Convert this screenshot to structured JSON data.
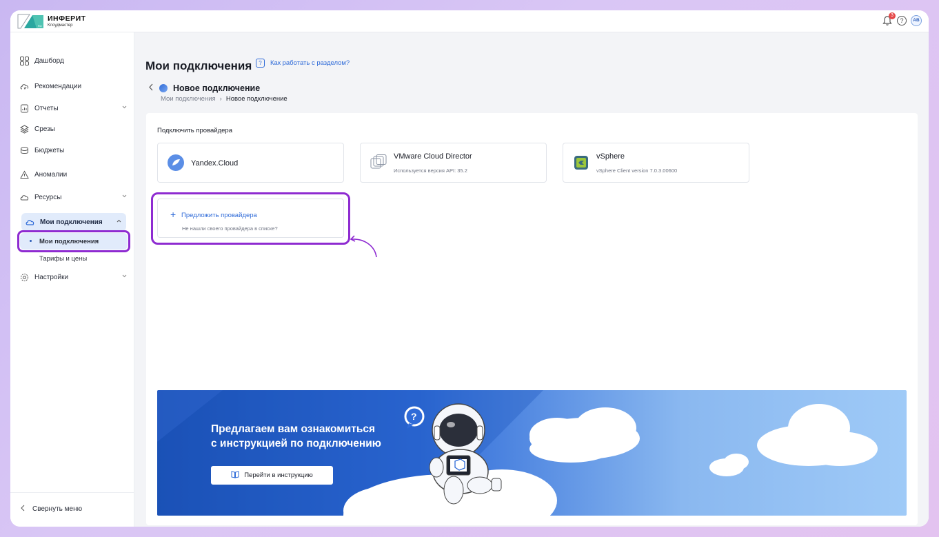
{
  "app": {
    "logo_title": "ИНФЕРИТ",
    "logo_subtitle": "Клоудмастер",
    "notifications_count": "3",
    "user_initials": "AB"
  },
  "sidebar": {
    "items": [
      {
        "label": "Дашборд",
        "icon": "dashboard-icon"
      },
      {
        "label": "Рекомендации",
        "icon": "recommendations-icon"
      },
      {
        "label": "Отчеты",
        "icon": "reports-icon"
      },
      {
        "label": "Срезы",
        "icon": "layers-icon"
      },
      {
        "label": "Бюджеты",
        "icon": "budget-icon"
      },
      {
        "label": "Аномалии",
        "icon": "warning-icon"
      },
      {
        "label": "Ресурсы",
        "icon": "resources-icon"
      },
      {
        "label": "Мои подключения",
        "icon": "cloud-icon"
      },
      {
        "label": "Настройки",
        "icon": "gear-icon"
      }
    ],
    "sub_items": [
      {
        "label": "Мои подключения"
      },
      {
        "label": "Тарифы и цены"
      }
    ],
    "collapse_label": "Свернуть меню"
  },
  "main": {
    "page_title": "Мои подключения",
    "help_link": "Как работать с разделом?",
    "subpage_title": "Новое подключение",
    "breadcrumbs": [
      "Мои подключения",
      "Новое подключение"
    ],
    "section_label": "Подключить провайдера",
    "providers": [
      {
        "name": "Yandex.Cloud",
        "sub": ""
      },
      {
        "name": "VMware Cloud Director",
        "sub": "Используется версия API: 35.2"
      },
      {
        "name": "vSphere",
        "sub": "vSphere Client version 7.0.3.00600"
      }
    ],
    "suggest": {
      "title": "Предложить провайдера",
      "sub": "Не нашли своего провайдера в списке?"
    },
    "banner": {
      "line1": "Предлагаем вам ознакомиться",
      "line2": "с инструкцией по подключению",
      "button": "Перейти в инструкцию"
    }
  },
  "colors": {
    "accent": "#2f6bd8",
    "highlight": "#8e2bd1",
    "active_bg": "#e1ebfb"
  }
}
